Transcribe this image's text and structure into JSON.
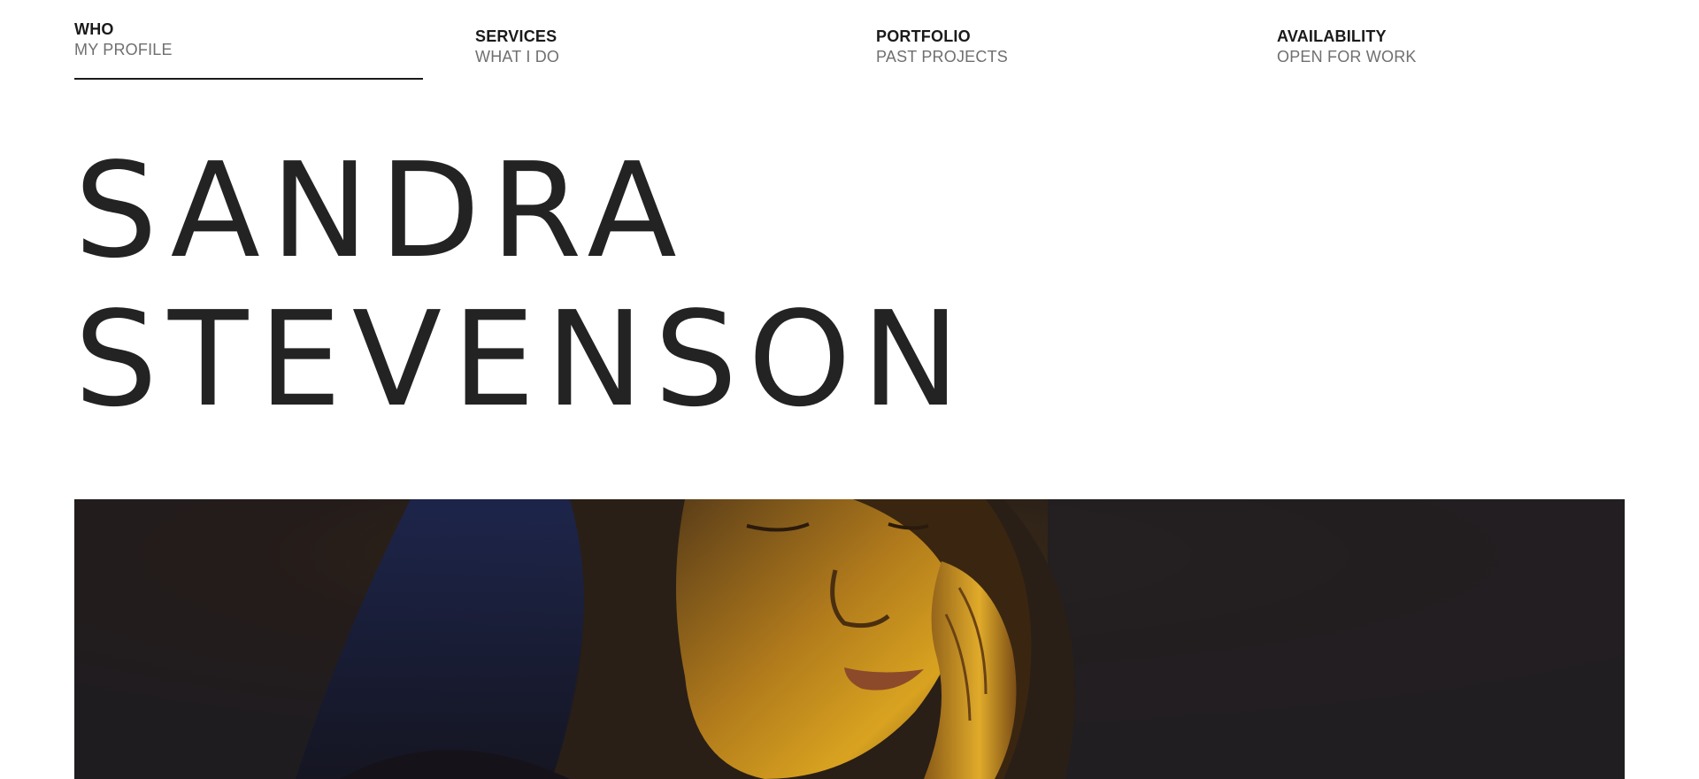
{
  "nav": {
    "items": [
      {
        "title": "WHO",
        "subtitle": "MY PROFILE",
        "active": true
      },
      {
        "title": "SERVICES",
        "subtitle": "WHAT I DO",
        "active": false
      },
      {
        "title": "PORTFOLIO",
        "subtitle": "PAST PROJECTS",
        "active": false
      },
      {
        "title": "AVAILABILITY",
        "subtitle": "OPEN FOR WORK",
        "active": false
      }
    ]
  },
  "hero": {
    "first_name": "SANDRA",
    "last_name": "STEVENSON"
  },
  "photo": {
    "subject": "portrait-photo",
    "colors": {
      "background": "#221e22",
      "skin_highlight": "#d49a1c",
      "hair": "#2a1f16",
      "blue_light": "#1c2a55"
    }
  }
}
